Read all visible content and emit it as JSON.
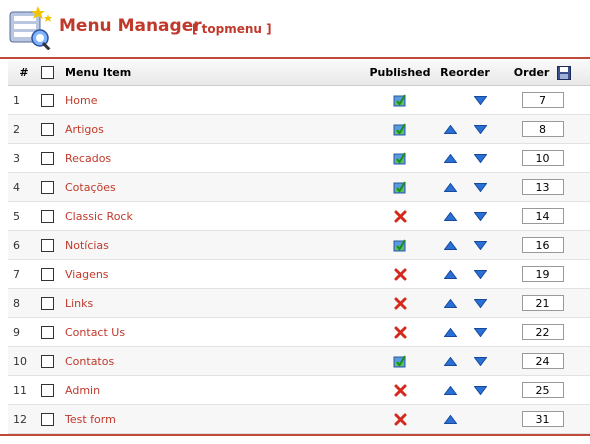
{
  "page": {
    "title": "Menu Manager",
    "subtitle": "[ topmenu ]"
  },
  "table": {
    "headers": {
      "num": "#",
      "item": "Menu Item",
      "published": "Published",
      "reorder": "Reorder",
      "order": "Order"
    },
    "rows": [
      {
        "num": "1",
        "label": "Home",
        "published": true,
        "up": false,
        "down": true,
        "order": "7"
      },
      {
        "num": "2",
        "label": "Artigos",
        "published": true,
        "up": true,
        "down": true,
        "order": "8"
      },
      {
        "num": "3",
        "label": "Recados",
        "published": true,
        "up": true,
        "down": true,
        "order": "10"
      },
      {
        "num": "4",
        "label": "Cotações",
        "published": true,
        "up": true,
        "down": true,
        "order": "13"
      },
      {
        "num": "5",
        "label": "Classic Rock",
        "published": false,
        "up": true,
        "down": true,
        "order": "14"
      },
      {
        "num": "6",
        "label": "Notícias",
        "published": true,
        "up": true,
        "down": true,
        "order": "16"
      },
      {
        "num": "7",
        "label": "Viagens",
        "published": false,
        "up": true,
        "down": true,
        "order": "19"
      },
      {
        "num": "8",
        "label": "Links",
        "published": false,
        "up": true,
        "down": true,
        "order": "21"
      },
      {
        "num": "9",
        "label": "Contact Us",
        "published": false,
        "up": true,
        "down": true,
        "order": "22"
      },
      {
        "num": "10",
        "label": "Contatos",
        "published": true,
        "up": true,
        "down": true,
        "order": "24"
      },
      {
        "num": "11",
        "label": "Admin",
        "published": false,
        "up": true,
        "down": true,
        "order": "25"
      },
      {
        "num": "12",
        "label": "Test form",
        "published": false,
        "up": true,
        "down": false,
        "order": "31"
      }
    ]
  },
  "colors": {
    "accent": "#c0392b",
    "arrow": "#2a6fd6",
    "unpublished": "#d42a1e"
  },
  "icons": {
    "logo": "menu-manager-icon",
    "save_order": "save-order-icon",
    "published": "published-icon",
    "unpublished": "unpublished-icon",
    "up": "move-up-icon",
    "down": "move-down-icon"
  }
}
